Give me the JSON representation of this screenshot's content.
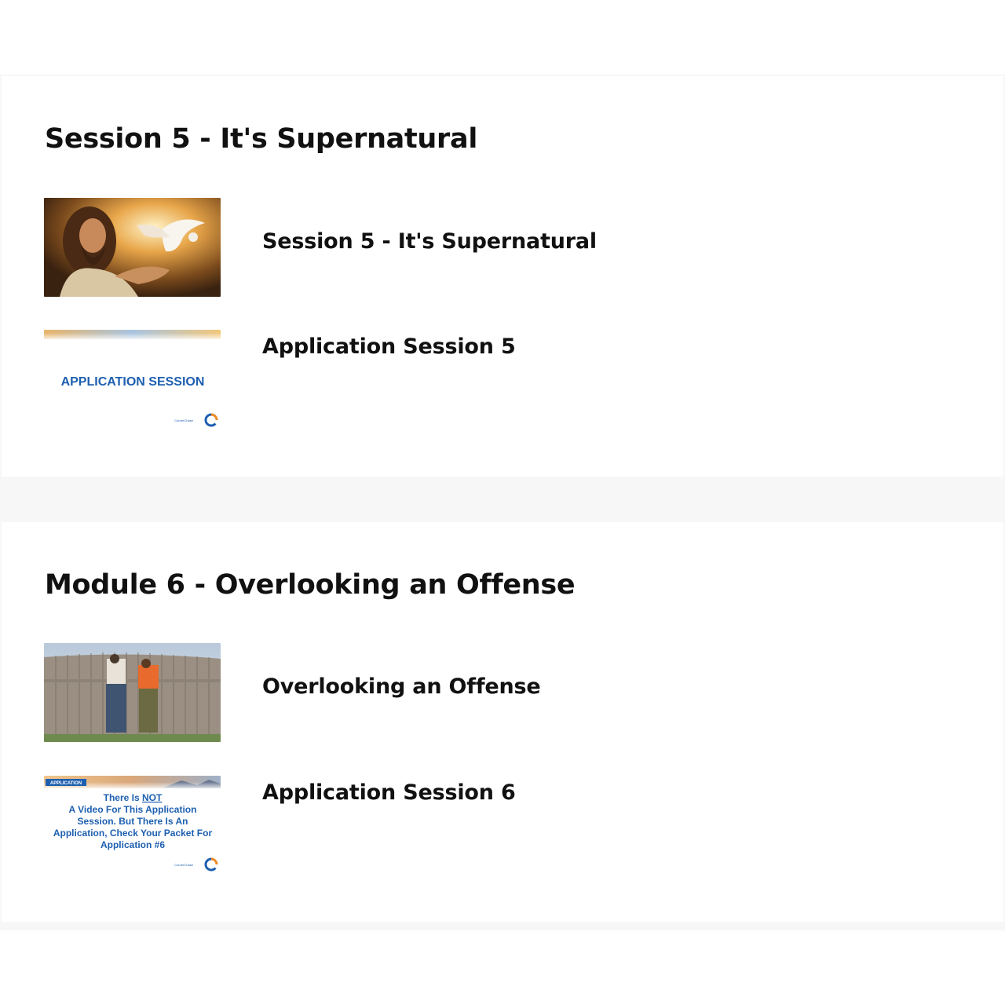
{
  "modules": [
    {
      "title": "Session 5 - It's Supernatural",
      "lessons": [
        {
          "title": "Session 5 - It's Supernatural",
          "thumbnail": "jesus-with-dove-image"
        },
        {
          "title": "Application Session 5",
          "thumbnail": "application-session-slide",
          "thumb_text": "APPLICATION SESSION",
          "logo_text": "CornerChase"
        }
      ]
    },
    {
      "title": "Module 6 - Overlooking an Offense",
      "lessons": [
        {
          "title": "Overlooking an Offense",
          "thumbnail": "two-men-looking-over-fence-image"
        },
        {
          "title": "Application Session 6",
          "thumbnail": "no-video-application-slide",
          "thumb_badge": "APPLICATION",
          "thumb_line1_pre": "There Is ",
          "thumb_line1_em": "NOT",
          "thumb_line2": "A Video For This Application",
          "thumb_line3": "Session.  But There Is An",
          "thumb_line4": "Application, Check Your Packet For",
          "thumb_line5": "Application #6",
          "logo_text": "CornerChase"
        }
      ]
    }
  ],
  "colors": {
    "heading": "#111111",
    "app_blue": "#1d5fb0",
    "logo_orange": "#f08a24",
    "page_bg": "#f7f7f7",
    "card_bg": "#ffffff"
  }
}
